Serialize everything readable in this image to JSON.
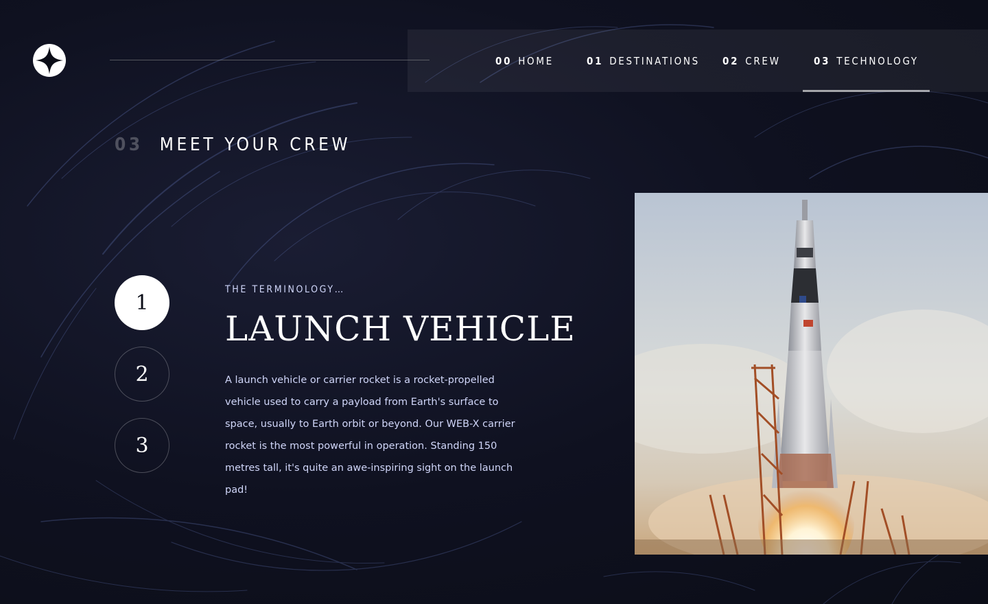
{
  "nav": {
    "items": [
      {
        "num": "00",
        "label": "HOME"
      },
      {
        "num": "01",
        "label": "DESTINATIONS"
      },
      {
        "num": "02",
        "label": "CREW"
      },
      {
        "num": "03",
        "label": "TECHNOLOGY"
      }
    ],
    "active_index": 3
  },
  "page": {
    "heading_num": "03",
    "heading_text": "MEET YOUR CREW"
  },
  "steps": {
    "items": [
      "1",
      "2",
      "3"
    ],
    "active_index": 0
  },
  "content": {
    "eyebrow": "THE TERMINOLOGY…",
    "title": "LAUNCH VEHICLE",
    "description": "A launch vehicle or carrier rocket is a rocket-propelled vehicle used to carry a payload from Earth's surface to space, usually to Earth orbit or beyond. Our WEB-X carrier rocket is the most powerful in operation. Standing 150 metres tall, it's quite an awe-inspiring sight on the launch pad!"
  },
  "colors": {
    "background": "#0b0d17",
    "accent_text": "#d0d6f9",
    "white": "#ffffff"
  },
  "icons": {
    "logo": "star-logo-icon"
  }
}
